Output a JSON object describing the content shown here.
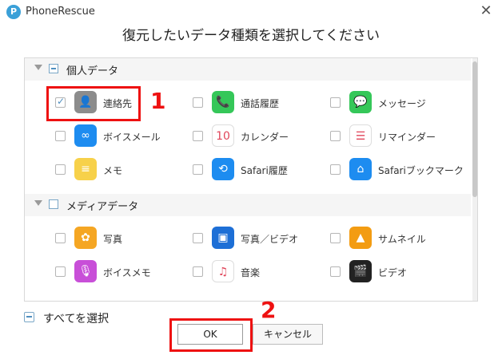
{
  "window": {
    "title": "PhoneRescue",
    "logo_letter": "P",
    "close_glyph": "✕"
  },
  "heading": "復元したいデータ種類を選択してください",
  "sections": [
    {
      "label": "個人データ",
      "items": [
        {
          "label": "連絡先",
          "checked": true,
          "icon": "contacts-icon",
          "color": "#8c8c8c",
          "glyph": "👤"
        },
        {
          "label": "通話履歴",
          "checked": false,
          "icon": "phone-icon",
          "color": "#35c759",
          "glyph": "📞"
        },
        {
          "label": "メッセージ",
          "checked": false,
          "icon": "messages-icon",
          "color": "#35c759",
          "glyph": "💬"
        },
        {
          "label": "ボイスメール",
          "checked": false,
          "icon": "voicemail-icon",
          "color": "#1d8cf0",
          "glyph": "∞"
        },
        {
          "label": "カレンダー",
          "checked": false,
          "icon": "calendar-icon",
          "color": "#ffffff",
          "glyph": "10"
        },
        {
          "label": "リマインダー",
          "checked": false,
          "icon": "reminders-icon",
          "color": "#ffffff",
          "glyph": "☰"
        },
        {
          "label": "メモ",
          "checked": false,
          "icon": "notes-icon",
          "color": "#f7d14a",
          "glyph": "≡"
        },
        {
          "label": "Safari履歴",
          "checked": false,
          "icon": "safari-history-icon",
          "color": "#1d8cf0",
          "glyph": "⟲"
        },
        {
          "label": "Safariブックマーク",
          "checked": false,
          "icon": "safari-bookmark-icon",
          "color": "#1d8cf0",
          "glyph": "⌂"
        }
      ]
    },
    {
      "label": "メディアデータ",
      "items": [
        {
          "label": "写真",
          "checked": false,
          "icon": "photos-icon",
          "color": "#f5a623",
          "glyph": "✿"
        },
        {
          "label": "写真／ビデオ",
          "checked": false,
          "icon": "photo-video-icon",
          "color": "#1d6fd6",
          "glyph": "▣"
        },
        {
          "label": "サムネイル",
          "checked": false,
          "icon": "thumbnail-icon",
          "color": "#f39c12",
          "glyph": "▲"
        },
        {
          "label": "ボイスメモ",
          "checked": false,
          "icon": "voice-memo-icon",
          "color": "#c84fd8",
          "glyph": "🎙"
        },
        {
          "label": "音楽",
          "checked": false,
          "icon": "music-icon",
          "color": "#ffffff",
          "glyph": "♫"
        },
        {
          "label": "ビデオ",
          "checked": false,
          "icon": "video-icon",
          "color": "#222222",
          "glyph": "🎬"
        }
      ]
    }
  ],
  "select_all_label": "すべてを選択",
  "buttons": {
    "ok": "OK",
    "cancel": "キャンセル"
  },
  "annotations": {
    "step1": "1",
    "step2": "2"
  }
}
